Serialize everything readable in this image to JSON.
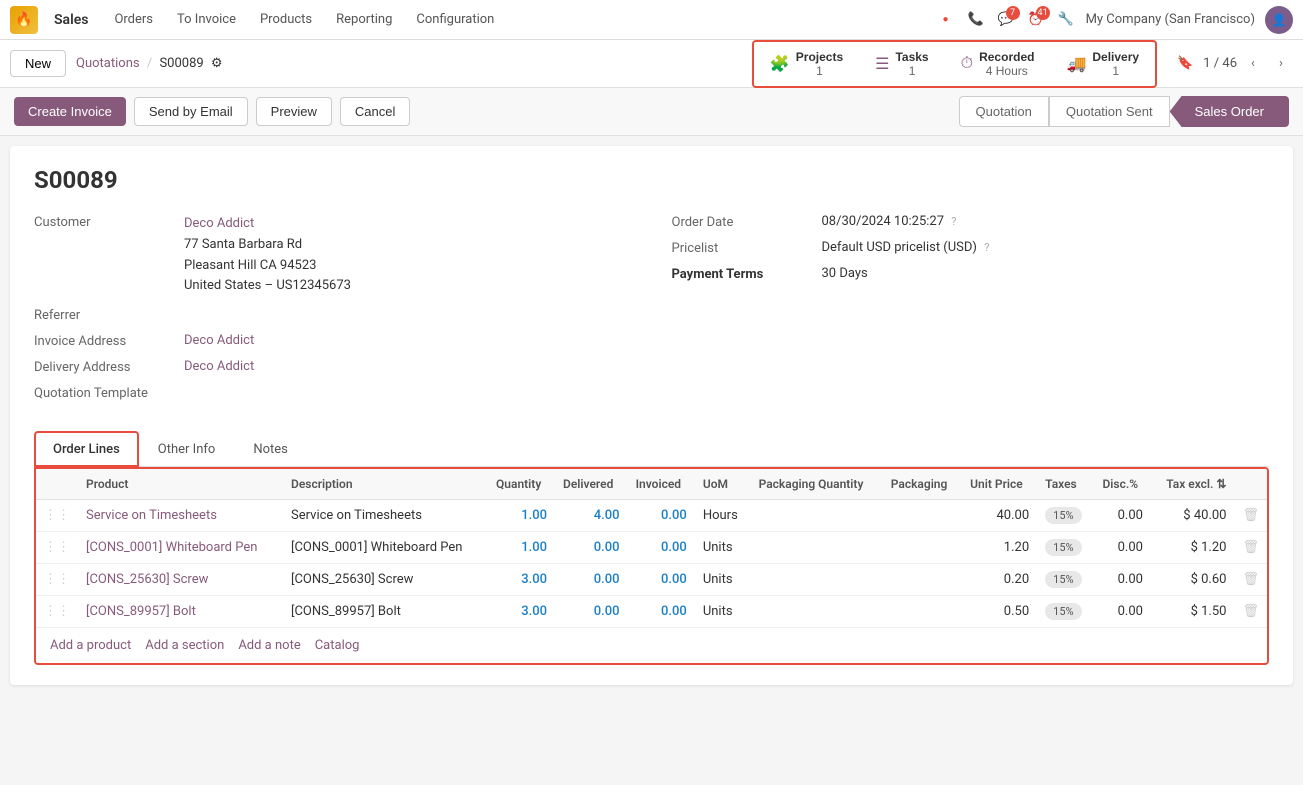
{
  "topnav": {
    "logo": "🔥",
    "app": "Sales",
    "items": [
      "Orders",
      "To Invoice",
      "Products",
      "Reporting",
      "Configuration"
    ],
    "company": "My Company (San Francisco)",
    "pager": "1 / 46"
  },
  "breadcrumb": {
    "new_label": "New",
    "parent": "Quotations",
    "current": "S00089"
  },
  "smart_buttons": [
    {
      "id": "projects",
      "icon": "🧩",
      "label": "Projects",
      "count": "1"
    },
    {
      "id": "tasks",
      "icon": "☰",
      "label": "Tasks",
      "count": "1"
    },
    {
      "id": "recorded",
      "icon": "⏱",
      "label": "Recorded\n4 Hours",
      "count": ""
    },
    {
      "id": "delivery",
      "icon": "🚚",
      "label": "Delivery",
      "count": "1"
    }
  ],
  "action_buttons": {
    "create_invoice": "Create Invoice",
    "send_email": "Send by Email",
    "preview": "Preview",
    "cancel": "Cancel"
  },
  "status_bar": {
    "quotation": "Quotation",
    "quotation_sent": "Quotation Sent",
    "sales_order": "Sales Order"
  },
  "order": {
    "number": "S00089",
    "customer_label": "Customer",
    "customer_name": "Deco Addict",
    "address_line1": "77 Santa Barbara Rd",
    "address_line2": "Pleasant Hill CA 94523",
    "address_line3": "United States – US12345673",
    "referrer_label": "Referrer",
    "invoice_address_label": "Invoice Address",
    "invoice_address": "Deco Addict",
    "delivery_address_label": "Delivery Address",
    "delivery_address": "Deco Addict",
    "quotation_template_label": "Quotation Template",
    "order_date_label": "Order Date",
    "order_date": "08/30/2024 10:25:27",
    "pricelist_label": "Pricelist",
    "pricelist": "Default USD pricelist (USD)",
    "payment_terms_label": "Payment Terms",
    "payment_terms": "30 Days"
  },
  "tabs": {
    "order_lines": "Order Lines",
    "other_info": "Other Info",
    "notes": "Notes"
  },
  "table": {
    "columns": [
      "Product",
      "Description",
      "Quantity",
      "Delivered",
      "Invoiced",
      "UoM",
      "Packaging Quantity",
      "Packaging",
      "Unit Price",
      "Taxes",
      "Disc.%",
      "Tax excl."
    ],
    "rows": [
      {
        "product": "Service on Timesheets",
        "description": "Service on Timesheets",
        "quantity": "1.00",
        "delivered": "4.00",
        "invoiced": "0.00",
        "uom": "Hours",
        "packaging_qty": "",
        "packaging": "",
        "unit_price": "40.00",
        "taxes": "15%",
        "disc": "0.00",
        "tax_excl": "$ 40.00"
      },
      {
        "product": "[CONS_0001] Whiteboard Pen",
        "description": "[CONS_0001] Whiteboard Pen",
        "quantity": "1.00",
        "delivered": "0.00",
        "invoiced": "0.00",
        "uom": "Units",
        "packaging_qty": "",
        "packaging": "",
        "unit_price": "1.20",
        "taxes": "15%",
        "disc": "0.00",
        "tax_excl": "$ 1.20"
      },
      {
        "product": "[CONS_25630] Screw",
        "description": "[CONS_25630] Screw",
        "quantity": "3.00",
        "delivered": "0.00",
        "invoiced": "0.00",
        "uom": "Units",
        "packaging_qty": "",
        "packaging": "",
        "unit_price": "0.20",
        "taxes": "15%",
        "disc": "0.00",
        "tax_excl": "$ 0.60"
      },
      {
        "product": "[CONS_89957] Bolt",
        "description": "[CONS_89957] Bolt",
        "quantity": "3.00",
        "delivered": "0.00",
        "invoiced": "0.00",
        "uom": "Units",
        "packaging_qty": "",
        "packaging": "",
        "unit_price": "0.50",
        "taxes": "15%",
        "disc": "0.00",
        "tax_excl": "$ 1.50"
      }
    ],
    "add_product": "Add a product",
    "add_section": "Add a section",
    "add_note": "Add a note",
    "catalog": "Catalog"
  }
}
